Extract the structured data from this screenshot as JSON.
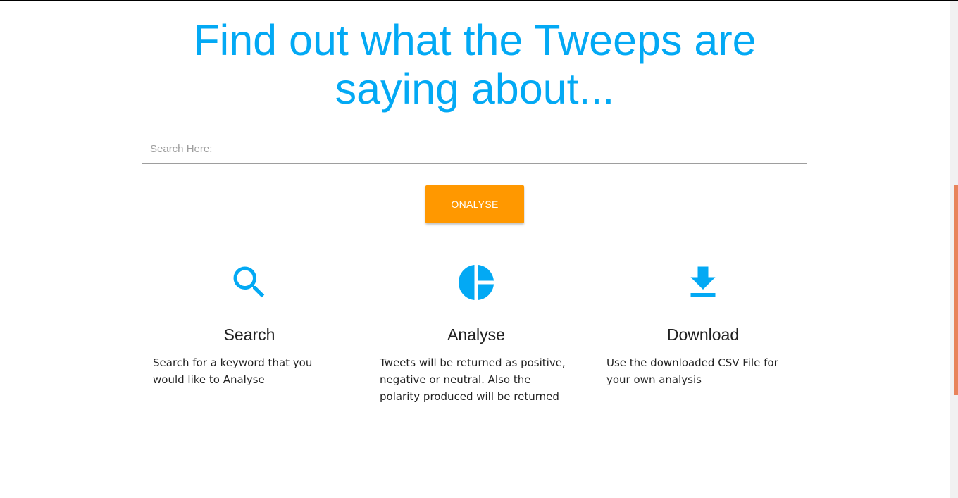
{
  "hero": {
    "title": "Find out what the Tweeps are saying about..."
  },
  "search": {
    "placeholder": "Search Here:",
    "value": ""
  },
  "actions": {
    "analyse_label": "ONALYSE"
  },
  "features": [
    {
      "icon": "search-icon",
      "heading": "Search",
      "text": "Search for a keyword that you would like to Analyse"
    },
    {
      "icon": "pie-chart-icon",
      "heading": "Analyse",
      "text": "Tweets will be returned as positive, negative or neutral. Also the polarity produced will be returned"
    },
    {
      "icon": "download-icon",
      "heading": "Download",
      "text": "Use the downloaded CSV File for your own analysis"
    }
  ],
  "colors": {
    "primary": "#03a9f4",
    "accent": "#ff9800",
    "scrollbar_thumb": "#e8845a"
  }
}
